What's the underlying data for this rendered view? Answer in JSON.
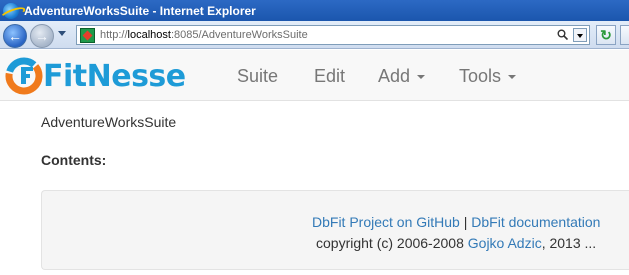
{
  "window": {
    "title": "AdventureWorksSuite - Internet Explorer"
  },
  "browser": {
    "url_prefix": "http://",
    "url_host": "localhost",
    "url_path": ":8085/AdventureWorksSuite"
  },
  "nav": {
    "brand": "FitNesse",
    "items": [
      {
        "label": "Suite"
      },
      {
        "label": "Edit"
      },
      {
        "label": "Add"
      },
      {
        "label": "Tools"
      }
    ]
  },
  "page": {
    "title": "AdventureWorksSuite",
    "contents_label": "Contents:"
  },
  "footer": {
    "link_github": "DbFit Project on GitHub",
    "separator": "|",
    "link_docs": "DbFit documentation",
    "copyright_prefix": "copyright (c) 2006-2008",
    "author_link": "Gojko Adzic",
    "copyright_suffix": ", 2013 ..."
  },
  "colors": {
    "brand": "#1e9bd7",
    "link": "#337ab7",
    "titlebar": "#1b56ad"
  }
}
